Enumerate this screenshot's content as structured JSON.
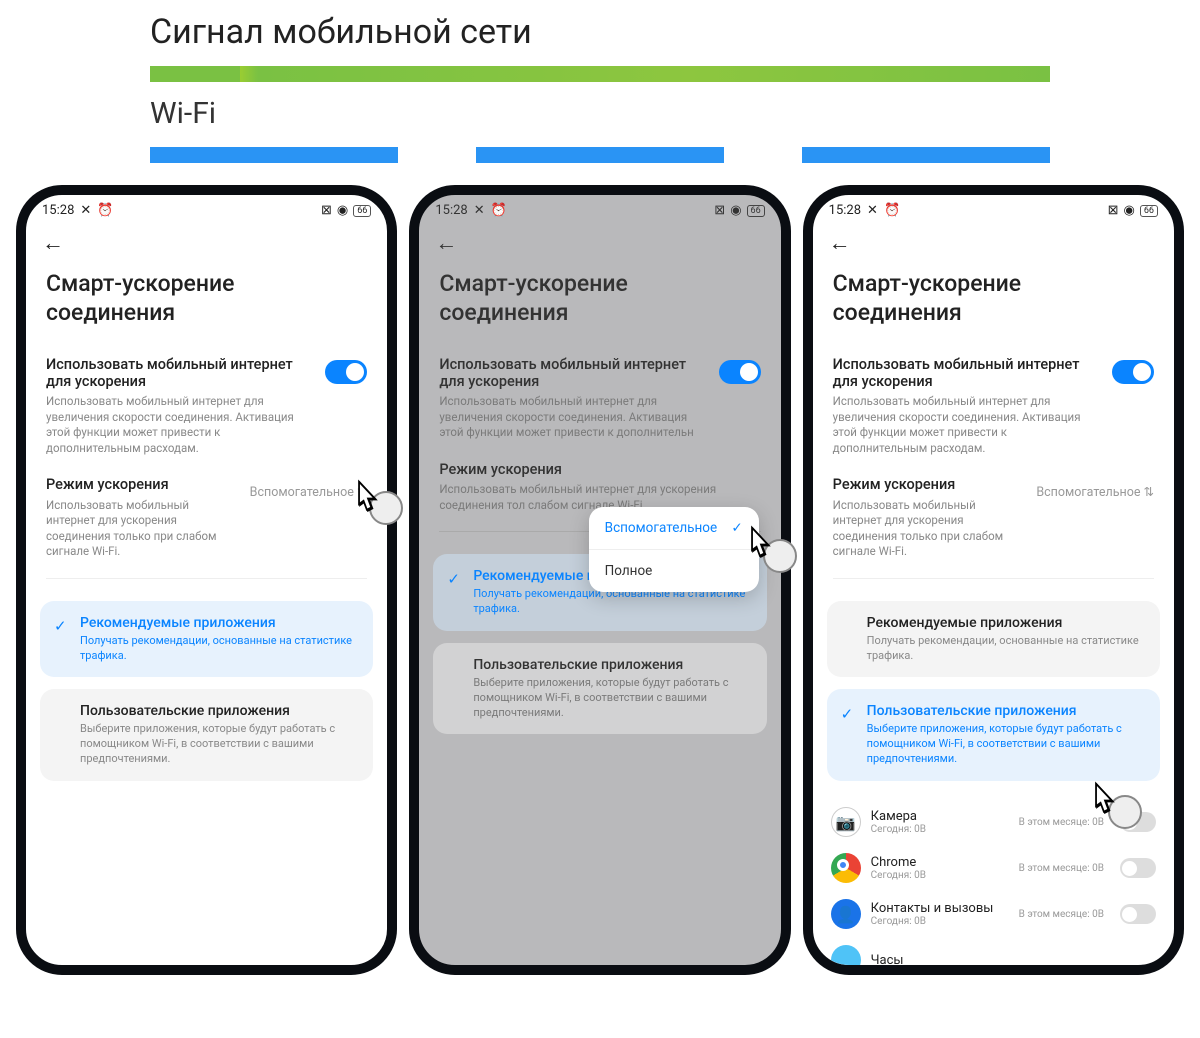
{
  "page": {
    "title": "Сигнал мобильной сети",
    "subtitle": "Wi-Fi"
  },
  "status": {
    "time": "15:28",
    "battery": "66"
  },
  "screen": {
    "title": "Смарт-ускорение соединения",
    "setting1_title": "Использовать мобильный интернет для ускорения",
    "setting1_desc": "Использовать мобильный интернет для увеличения скорости соединения. Активация этой функции может привести к дополнительным расходам.",
    "setting1_desc_cut": "Использовать мобильный интернет для увеличения скорости соединения. Активация этой функции может привести к дополнительн",
    "mode_title": "Режим ускорения",
    "mode_desc": "Использовать мобильный интернет для ускорения соединения только при слабом сигнале Wi-Fi.",
    "mode_desc_cut": "Использовать мобильный интернет для ускорения соединения тол слабом сигнале Wi-Fi.",
    "mode_value": "Вспомогательное"
  },
  "cards": {
    "rec_title": "Рекомендуемые приложения",
    "rec_desc": "Получать рекомендации, основанные на статистике трафика.",
    "user_title": "Пользовательские приложения",
    "user_desc": "Выберите приложения, которые будут работать с помощником Wi-Fi, в соответствии с вашими предпочтениями."
  },
  "popup": {
    "opt1": "Вспомогательное",
    "opt2": "Полное"
  },
  "apps": [
    {
      "name": "Камера",
      "today": "Сегодня: 0B",
      "month": "В этом месяце: 0B"
    },
    {
      "name": "Chrome",
      "today": "Сегодня: 0B",
      "month": "В этом месяце: 0B"
    },
    {
      "name": "Контакты и вызовы",
      "today": "Сегодня: 0B",
      "month": "В этом месяце: 0B"
    },
    {
      "name": "Часы",
      "today": "",
      "month": ""
    }
  ]
}
